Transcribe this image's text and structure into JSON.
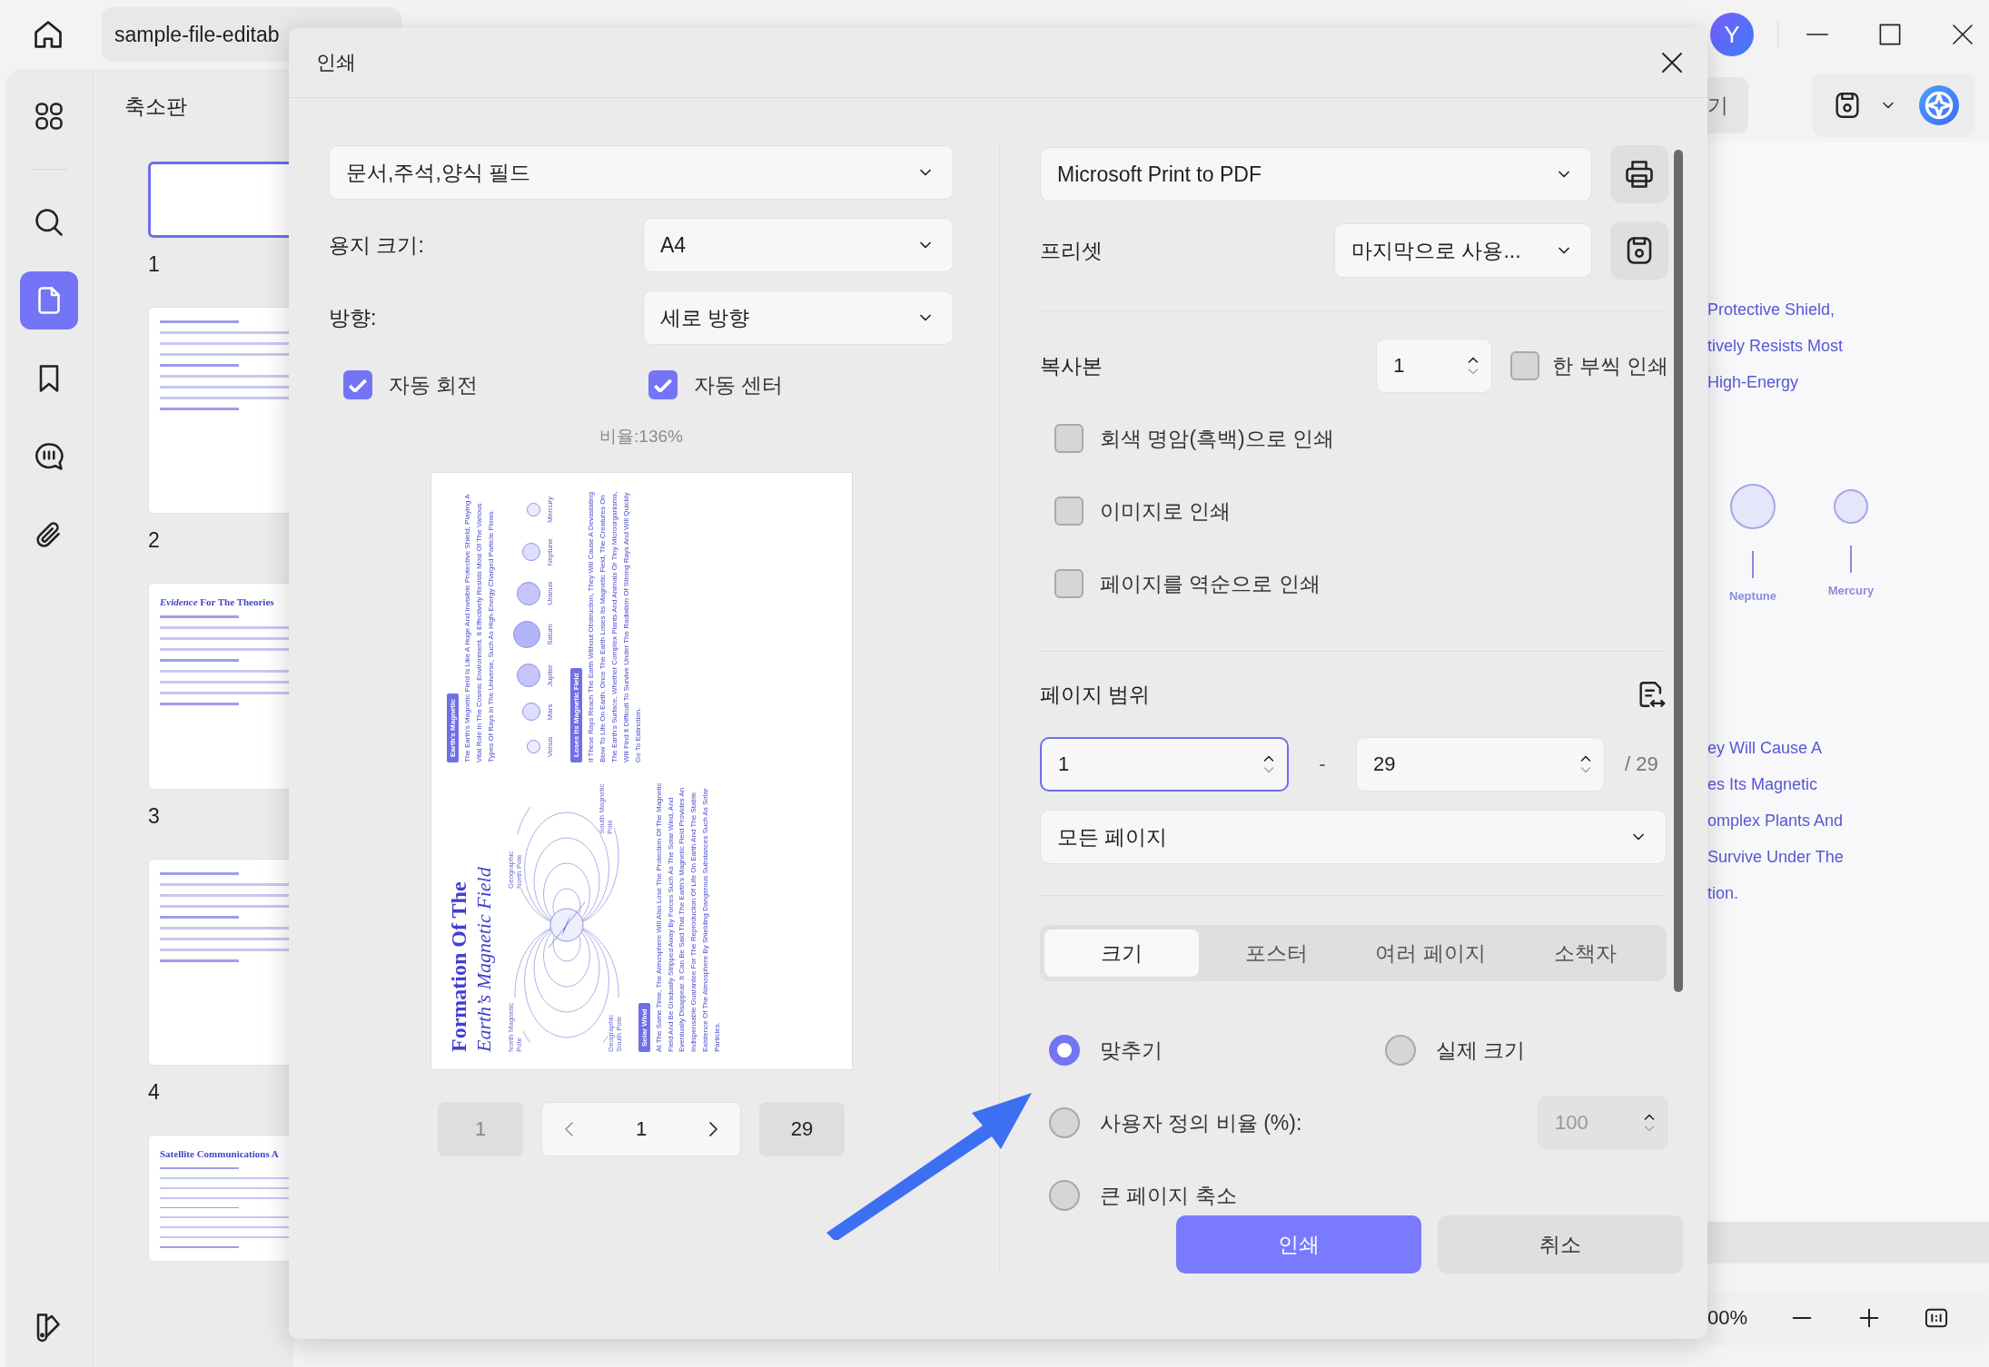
{
  "app_tab": {
    "title": "sample-file-editab"
  },
  "avatar": {
    "initial": "Y"
  },
  "sidebar": {
    "items": [
      {
        "kind": "apps",
        "selected": false
      },
      {
        "kind": "search",
        "selected": false
      },
      {
        "kind": "pages",
        "selected": true
      },
      {
        "kind": "bookmark",
        "selected": false
      },
      {
        "kind": "comment",
        "selected": false
      },
      {
        "kind": "attachment",
        "selected": false
      }
    ]
  },
  "thumbnails": {
    "title": "축소판",
    "pages": [
      {
        "label": "1",
        "selected": true
      },
      {
        "label": "2",
        "selected": false
      },
      {
        "label": "3",
        "selected": false,
        "heading": "*Evidence* For The Theories"
      },
      {
        "label": "4",
        "selected": false
      },
      {
        "selected": false,
        "heading": "Satellite Communications A"
      }
    ]
  },
  "document": {
    "toolbar_label": "기",
    "lines_top": [
      "Protective Shield,",
      "tively Resists Most",
      "High-Energy"
    ],
    "planets": [
      {
        "name": "Neptune"
      },
      {
        "name": "Mercury"
      }
    ],
    "lines_bottom": [
      "ey Will Cause A",
      "es Its Magnetic",
      "omplex Plants And",
      "Survive Under The",
      "tion."
    ],
    "zoom": "00%"
  },
  "dialog": {
    "title": "인쇄",
    "content_select": "문서,주석,양식 필드",
    "paper_size": {
      "label": "용지 크기:",
      "value": "A4"
    },
    "orientation": {
      "label": "방향:",
      "value": "세로 방향"
    },
    "options": [
      {
        "label": "자동 회전",
        "checked": true
      },
      {
        "label": "자동 센터",
        "checked": true
      }
    ],
    "scale_text": "비율:136%",
    "preview": {
      "title": [
        "Formation Of The",
        "Earth’s Magnetic Field"
      ],
      "diagram_labels": [
        "Geographic North Pole",
        "North Magnetic Pole",
        "South Magnetic Pole",
        "Geographic South Pole"
      ],
      "sections": [
        {
          "heading": "Earth's Magnetic",
          "text": "The Earth's Magnetic Field Is Like A Huge And Invisible Protective Shield, Playing A Vital Role In The Cosmic Environment. It Effectively Resists Most Of The Various Types Of Rays In The Universe, Such As High-Energy Charged Particle Flows."
        },
        {
          "heading": "Loses Its Magnetic Field",
          "text": "If These Rays Reach The Earth Without Obstruction, They Will Cause A Devastating Blow To Life On Earth. Once The Earth Loses Its Magnetic Field, The Creatures On The Earth's Surface, Whether Complex Plants And Animals Or Tiny Microorganisms, Will Find It Difficult To Survive Under The Radiation Of Strong Rays And Will Quickly Go To Extinction."
        },
        {
          "heading": "Solar Wind",
          "text": "At The Same Time, The Atmosphere Will Also Lose The Protection Of The Magnetic Field And Be Gradually Stripped Away By Forces Such As The Solar Wind, And Eventually Disappear. It Can Be Said That The Earth's Magnetic Field Provides An Indispensable Guarantee For The Reproduction Of Life On Earth And The Stable Existence Of The Atmosphere By Shielding Dangerous Substances Such As Solar Particles."
        }
      ],
      "planets": [
        {
          "name": "Venus"
        },
        {
          "name": "Mars"
        },
        {
          "name": "Jupiter"
        },
        {
          "name": "Saturn"
        },
        {
          "name": "Uranus"
        },
        {
          "name": "Neptune"
        },
        {
          "name": "Mercury"
        }
      ]
    },
    "pager": {
      "first": "1",
      "current": "1",
      "last": "29"
    },
    "printer": "Microsoft Print to PDF",
    "preset": {
      "label": "프리셋",
      "value": "마지막으로 사용..."
    },
    "copies": {
      "label": "복사본",
      "value": "1",
      "collate": {
        "label": "한 부씩 인쇄",
        "checked": false
      }
    },
    "print_options": [
      {
        "label": "회색 명암(흑백)으로 인쇄",
        "checked": false
      },
      {
        "label": "이미지로 인쇄",
        "checked": false
      },
      {
        "label": "페이지를 역순으로 인쇄",
        "checked": false
      }
    ],
    "page_range": {
      "label": "페이지 범위",
      "from": "1",
      "separator": "-",
      "to": "29",
      "total": "/ 29",
      "subset": "모든 페이지"
    },
    "tabs": [
      {
        "label": "크기",
        "selected": true
      },
      {
        "label": "포스터",
        "selected": false
      },
      {
        "label": "여러 페이지",
        "selected": false
      },
      {
        "label": "소책자",
        "selected": false
      }
    ],
    "sizing": [
      {
        "label": "맞추기",
        "selected": true
      },
      {
        "label": "실제 크기",
        "selected": false
      },
      {
        "label": "사용자 정의 비율 (%):",
        "selected": false,
        "value": "100",
        "disabled": true
      },
      {
        "label": "큰 페이지 축소",
        "selected": false
      }
    ],
    "buttons": [
      {
        "label": "인쇄",
        "kind": "primary"
      },
      {
        "label": "취소",
        "kind": "secondary"
      }
    ]
  }
}
